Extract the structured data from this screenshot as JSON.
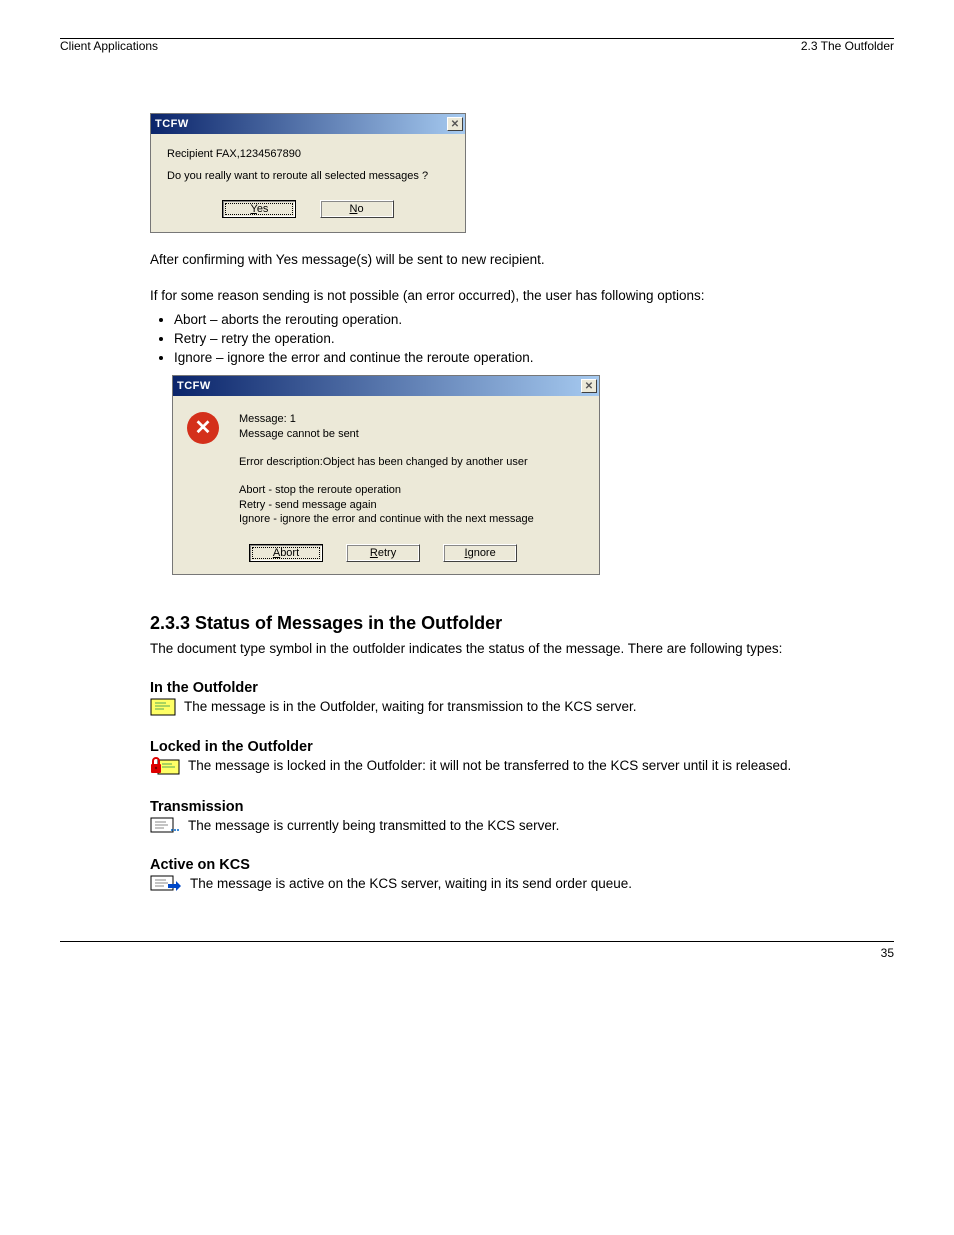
{
  "header": {
    "left": "Client Applications",
    "right": "2.3  The Outfolder"
  },
  "footer": {
    "page": "35"
  },
  "dialog1": {
    "title": "TCFW",
    "line1": "Recipient FAX,1234567890",
    "line2": "Do you really want to reroute all selected messages ?",
    "yes": "Yes",
    "no": "No"
  },
  "para1": "After confirming with Yes message(s) will be sent to new recipient.",
  "para2": "If for some reason sending is not possible (an error occurred), the user has following options:",
  "bullets": {
    "b1": "Abort – aborts the rerouting operation.",
    "b2": "Retry – retry the operation.",
    "b3": "Ignore – ignore the error and continue the reroute operation."
  },
  "dialog2": {
    "title": "TCFW",
    "l1": "Message: 1",
    "l2": "Message cannot be sent",
    "l3": "Error description:Object has been changed by another user",
    "l4": "Abort - stop the reroute operation",
    "l5": "Retry - send message again",
    "l6": "Ignore - ignore the error and continue with the next message",
    "abort": "Abort",
    "retry": "Retry",
    "ignore": "Ignore"
  },
  "h3": "2.3.3  Status of Messages in the Outfolder",
  "p_status": "The document type symbol in the outfolder indicates the status of the message. There are following types:",
  "s1": {
    "title": "In the Outfolder",
    "desc": "The message is in the Outfolder, waiting for transmission to the KCS server."
  },
  "s2": {
    "title": "Locked in the Outfolder",
    "desc": "The message is locked in the Outfolder: it will not be transferred to the KCS server until it is released."
  },
  "s3": {
    "title": "Transmission",
    "desc": "The message is currently being transmitted to the KCS server."
  },
  "s4": {
    "title": "Active on KCS",
    "desc": "The message is active on the KCS server, waiting in its send order queue."
  }
}
